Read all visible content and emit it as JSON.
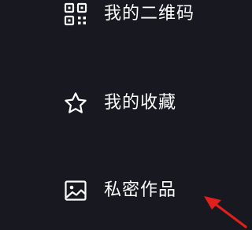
{
  "menu": {
    "items": [
      {
        "label": "我的二维码",
        "icon": "qr-code-icon"
      },
      {
        "label": "我的收藏",
        "icon": "star-icon"
      },
      {
        "label": "私密作品",
        "icon": "image-icon"
      }
    ]
  },
  "colors": {
    "background": "#171820",
    "text": "#ffffff",
    "icon": "#ffffff",
    "annotation_arrow": "#e0201c"
  }
}
